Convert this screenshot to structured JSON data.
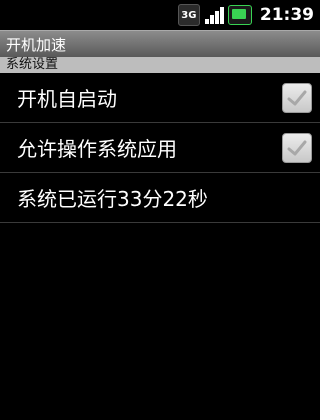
{
  "status_bar": {
    "network_label": "3G",
    "time": "21:39",
    "icons": [
      "3g-data-icon",
      "signal-strength-icon",
      "battery-charging-icon"
    ]
  },
  "title_bar": {
    "title": "开机加速"
  },
  "section": {
    "header": "系统设置"
  },
  "preferences": [
    {
      "label": "开机自启动",
      "checkbox": true,
      "checked": true
    },
    {
      "label": "允许操作系统应用",
      "checkbox": true,
      "checked": true
    },
    {
      "label": "系统已运行33分22秒",
      "checkbox": false
    }
  ],
  "colors": {
    "background": "#000000",
    "title_bar": "#707070",
    "section_header": "#bdbdbd",
    "battery_accent": "#39d353"
  }
}
